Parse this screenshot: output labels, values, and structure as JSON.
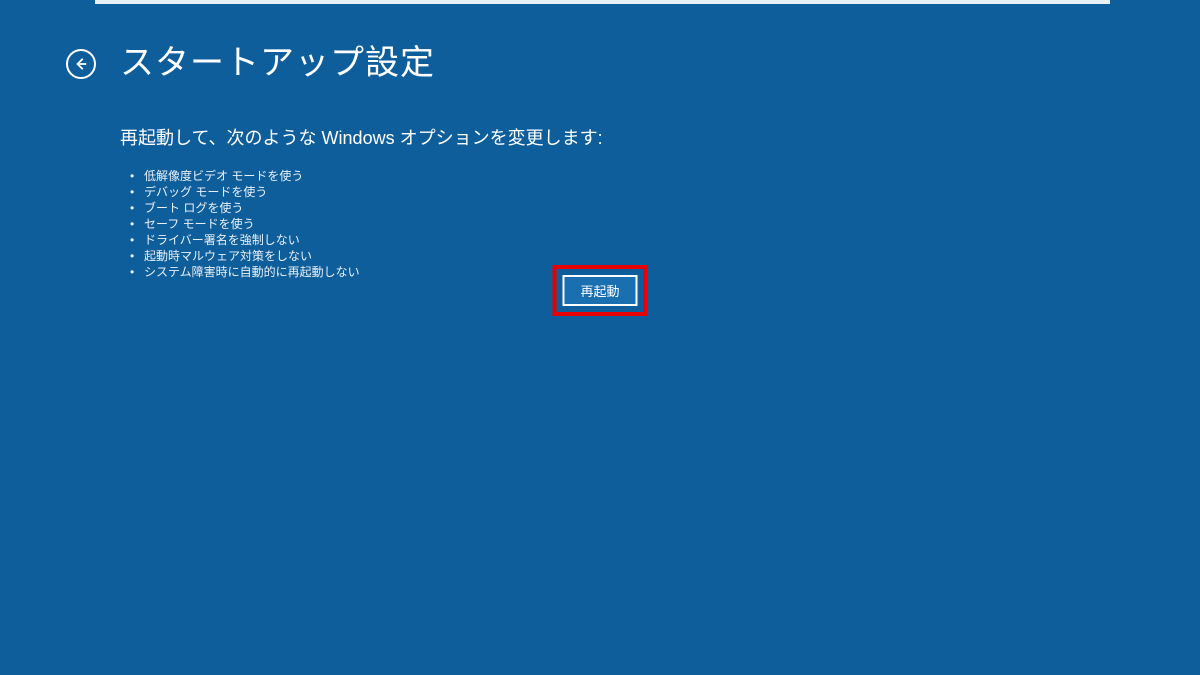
{
  "header": {
    "title": "スタートアップ設定"
  },
  "content": {
    "subtitle": "再起動して、次のような Windows オプションを変更します:",
    "options": [
      "低解像度ビデオ モードを使う",
      "デバッグ モードを使う",
      "ブート ログを使う",
      "セーフ モードを使う",
      "ドライバー署名を強制しない",
      "起動時マルウェア対策をしない",
      "システム障害時に自動的に再起動しない"
    ]
  },
  "button": {
    "restart_label": "再起動"
  }
}
